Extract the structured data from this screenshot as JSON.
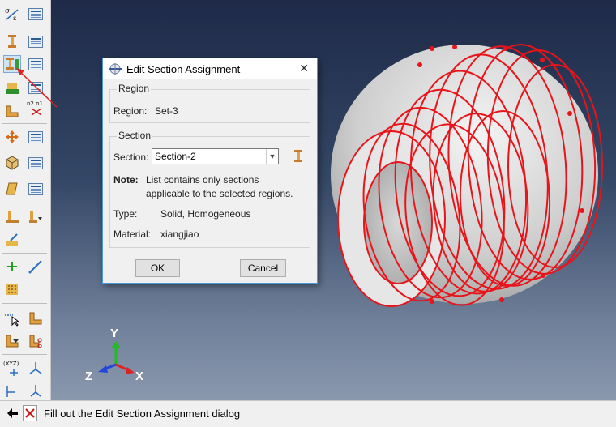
{
  "toolbox": {
    "tools": [
      {
        "name": "material-manager",
        "glyph": "σ/ε"
      },
      {
        "name": "section-create",
        "glyph": "⏚"
      },
      {
        "name": "section-assign",
        "glyph": "⏚"
      },
      {
        "name": "profile-create",
        "glyph": "▙"
      },
      {
        "name": "skin-create",
        "glyph": "∟"
      },
      {
        "name": "orientation-assign",
        "glyph": "n1n2"
      },
      {
        "name": "transform",
        "glyph": "✥"
      },
      {
        "name": "composite-layup",
        "glyph": "⬡"
      },
      {
        "name": "special-inertia",
        "glyph": "▱"
      },
      {
        "name": "spring-assign",
        "glyph": "⏚"
      },
      {
        "name": "stringer",
        "glyph": "⏚"
      },
      {
        "name": "create-wire",
        "glyph": "+"
      },
      {
        "name": "datum-axis",
        "glyph": "╱"
      },
      {
        "name": "partition",
        "glyph": "▦"
      },
      {
        "name": "query",
        "glyph": "↖"
      },
      {
        "name": "cut-shape",
        "glyph": "✂"
      },
      {
        "name": "datum-csys",
        "glyph": "(XYZ)"
      }
    ]
  },
  "dialog": {
    "title": "Edit Section Assignment",
    "close": "✕",
    "region_group": "Region",
    "region_label": "Region:",
    "region_value": "Set-3",
    "section_group": "Section",
    "section_label": "Section:",
    "section_value": "Section-2",
    "note_label": "Note:",
    "note_line1": "List contains only sections",
    "note_line2": "applicable to the selected regions.",
    "type_label": "Type:",
    "type_value": "Solid, Homogeneous",
    "material_label": "Material:",
    "material_value": "xiangjiao",
    "ok_label": "OK",
    "cancel_label": "Cancel"
  },
  "triad": {
    "y": "Y",
    "x": "X",
    "z": "Z"
  },
  "status": {
    "text": "Fill out the Edit Section Assignment dialog"
  },
  "colors": {
    "highlight_edges": "#e8141a",
    "dialog_border": "#4a9ad6",
    "viewport_top": "#1e2a48"
  }
}
